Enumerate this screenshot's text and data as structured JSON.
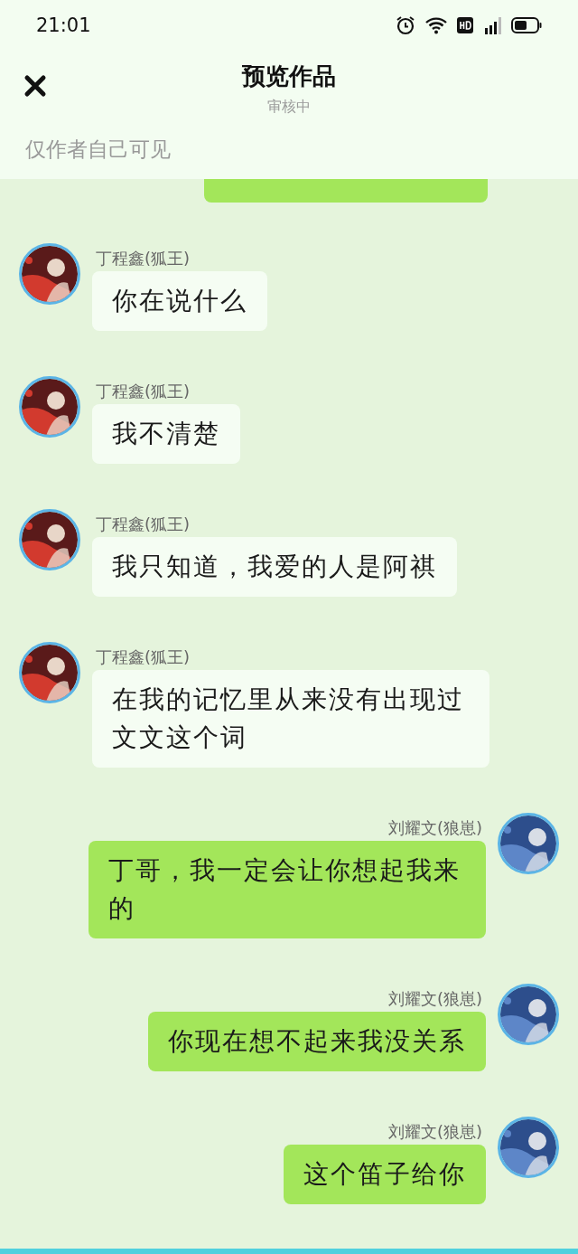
{
  "status_bar": {
    "time": "21:01"
  },
  "header": {
    "title": "预览作品",
    "subtitle": "审核中"
  },
  "notice": "仅作者自己可见",
  "messages": [
    {
      "kind": "cut_off",
      "outgoing": true
    },
    {
      "kind": "text",
      "outgoing": false,
      "name": "丁程鑫(狐王)",
      "text": "你在说什么"
    },
    {
      "kind": "text",
      "outgoing": false,
      "name": "丁程鑫(狐王)",
      "text": "我不清楚"
    },
    {
      "kind": "text",
      "outgoing": false,
      "name": "丁程鑫(狐王)",
      "text": "我只知道，我爱的人是阿祺"
    },
    {
      "kind": "text",
      "outgoing": false,
      "name": "丁程鑫(狐王)",
      "text": "在我的记忆里从来没有出现过文文这个词"
    },
    {
      "kind": "text",
      "outgoing": true,
      "name": "刘耀文(狼崽)",
      "text": "丁哥，我一定会让你想起我来的"
    },
    {
      "kind": "text",
      "outgoing": true,
      "name": "刘耀文(狼崽)",
      "text": "你现在想不起来我没关系"
    },
    {
      "kind": "text",
      "outgoing": true,
      "name": "刘耀文(狼崽)",
      "text": "这个笛子给你"
    }
  ]
}
